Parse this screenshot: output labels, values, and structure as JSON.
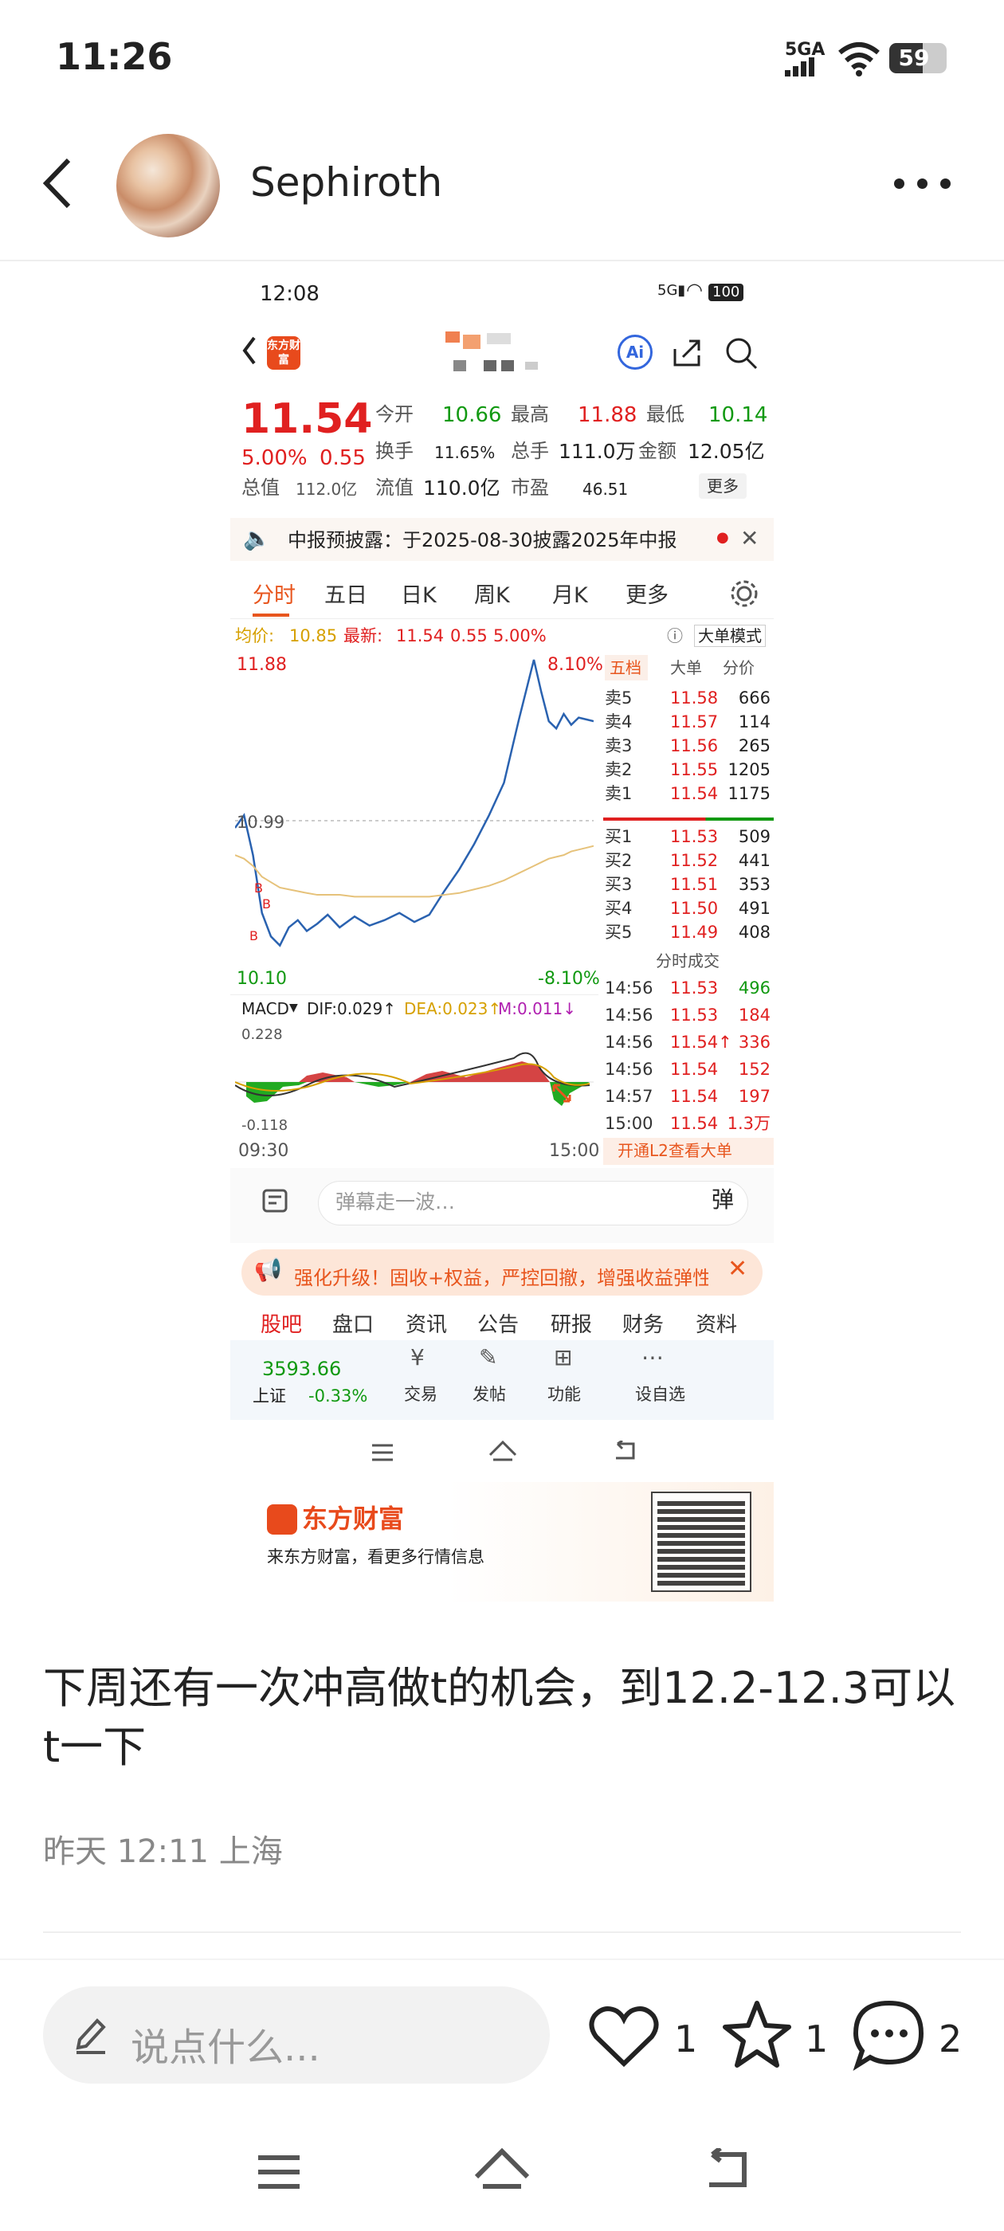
{
  "status_bar": {
    "time": "11:26",
    "network": "5GA",
    "battery": "59"
  },
  "header": {
    "username": "Sephiroth"
  },
  "screenshot": {
    "status_time": "12:08",
    "battery": "100",
    "logo_text": "东方财富",
    "ai_label": "Ai",
    "price": "11.54",
    "change_pct": "5.00%",
    "change_abs": "0.55",
    "stats": {
      "open_l": "今开",
      "open_v": "10.66",
      "high_l": "最高",
      "high_v": "11.88",
      "low_l": "最低",
      "low_v": "10.14",
      "turnover_l": "换手",
      "turnover_v": "11.65%",
      "vol_l": "总手",
      "vol_v": "111.0万",
      "amount_l": "金额",
      "amount_v": "12.05亿",
      "mcap_l": "总值",
      "mcap_v": "112.0亿",
      "float_l": "流值",
      "float_v": "110.0亿",
      "pe_l": "市盈",
      "pe_v": "46.51",
      "more": "更多"
    },
    "notice": "中报预披露：于2025-08-30披露2025年中报",
    "tabs": [
      "分时",
      "五日",
      "日K",
      "周K",
      "月K",
      "更多"
    ],
    "info_line": {
      "avg_l": "均价:",
      "avg_v": "10.85",
      "last_l": "最新:",
      "last_v": "11.54",
      "chg": "0.55",
      "pct": "5.00%",
      "big": "大单模式"
    },
    "chart_labels": {
      "high": "11.88",
      "mid": "10.99",
      "low": "10.10",
      "up_pct": "8.10%",
      "down_pct": "-8.10%",
      "t_start": "09:30",
      "t_end": "15:00"
    },
    "chart_data": {
      "type": "line",
      "x_range": [
        "09:30",
        "15:00"
      ],
      "ylim": [
        10.1,
        11.88
      ],
      "x": [
        0,
        6,
        12,
        18,
        24,
        30,
        36,
        42,
        48,
        55,
        62,
        70,
        80,
        90,
        100,
        110,
        120,
        130,
        140,
        150,
        160,
        170,
        180,
        190,
        200,
        205,
        210,
        215,
        220,
        225,
        230,
        235,
        240
      ],
      "series": [
        {
          "name": "价格",
          "values": [
            10.95,
            11.02,
            10.8,
            10.48,
            10.35,
            10.3,
            10.4,
            10.44,
            10.38,
            10.42,
            10.47,
            10.4,
            10.46,
            10.41,
            10.44,
            10.48,
            10.43,
            10.47,
            10.6,
            10.72,
            10.86,
            11.02,
            11.2,
            11.55,
            11.88,
            11.7,
            11.54,
            11.5,
            11.58,
            11.52,
            11.56,
            11.55,
            11.54
          ]
        },
        {
          "name": "均价",
          "values": [
            10.8,
            10.78,
            10.74,
            10.68,
            10.65,
            10.62,
            10.61,
            10.6,
            10.59,
            10.58,
            10.58,
            10.58,
            10.57,
            10.57,
            10.57,
            10.57,
            10.57,
            10.57,
            10.58,
            10.59,
            10.61,
            10.63,
            10.66,
            10.7,
            10.74,
            10.76,
            10.78,
            10.79,
            10.8,
            10.82,
            10.83,
            10.84,
            10.85
          ]
        }
      ]
    },
    "order_book": {
      "title": "五档",
      "col2": "大单",
      "col3": "分价",
      "asks": [
        {
          "l": "卖5",
          "p": "11.58",
          "v": "666"
        },
        {
          "l": "卖4",
          "p": "11.57",
          "v": "114"
        },
        {
          "l": "卖3",
          "p": "11.56",
          "v": "265"
        },
        {
          "l": "卖2",
          "p": "11.55",
          "v": "1205"
        },
        {
          "l": "卖1",
          "p": "11.54",
          "v": "1175"
        }
      ],
      "bids": [
        {
          "l": "买1",
          "p": "11.53",
          "v": "509"
        },
        {
          "l": "买2",
          "p": "11.52",
          "v": "441"
        },
        {
          "l": "买3",
          "p": "11.51",
          "v": "353"
        },
        {
          "l": "买4",
          "p": "11.50",
          "v": "491"
        },
        {
          "l": "买5",
          "p": "11.49",
          "v": "408"
        }
      ]
    },
    "trades_title": "分时成交",
    "trades": [
      {
        "t": "14:56",
        "p": "11.53",
        "v": "496"
      },
      {
        "t": "14:56",
        "p": "11.53",
        "v": "184"
      },
      {
        "t": "14:56",
        "p": "11.54↑",
        "v": "336"
      },
      {
        "t": "14:56",
        "p": "11.54",
        "v": "152"
      },
      {
        "t": "14:57",
        "p": "11.54",
        "v": "197"
      },
      {
        "t": "15:00",
        "p": "11.54",
        "v": "1.3万"
      }
    ],
    "l2_banner": "开通L2查看大单",
    "macd": {
      "label": "MACD",
      "dif": "DIF:0.029↑",
      "dea": "DEA:0.023↑",
      "m": "M:0.011↓",
      "top": "0.228",
      "bottom": "-0.118"
    },
    "danmu_placeholder": "弹幕走一波…",
    "promo": "强化升级！固收+权益，严控回撤，增强收益弹性",
    "sub_tabs": [
      "股吧",
      "盘口",
      "资讯",
      "公告",
      "研报",
      "财务",
      "资料"
    ],
    "bottom_bar": {
      "index_value": "3593.66",
      "index_name": "上证",
      "index_pct": "-0.33%",
      "items": [
        "交易",
        "发帖",
        "功能",
        "设自选"
      ]
    },
    "ad": {
      "brand": "东方财富",
      "tagline": "来东方财富，看更多行情信息"
    }
  },
  "post": {
    "text": "下周还有一次冲高做t的机会，到12.2-12.3可以t一下",
    "meta": "昨天 12:11 上海"
  },
  "action_bar": {
    "placeholder": "说点什么...",
    "likes": "1",
    "favorites": "1",
    "comments": "2"
  }
}
